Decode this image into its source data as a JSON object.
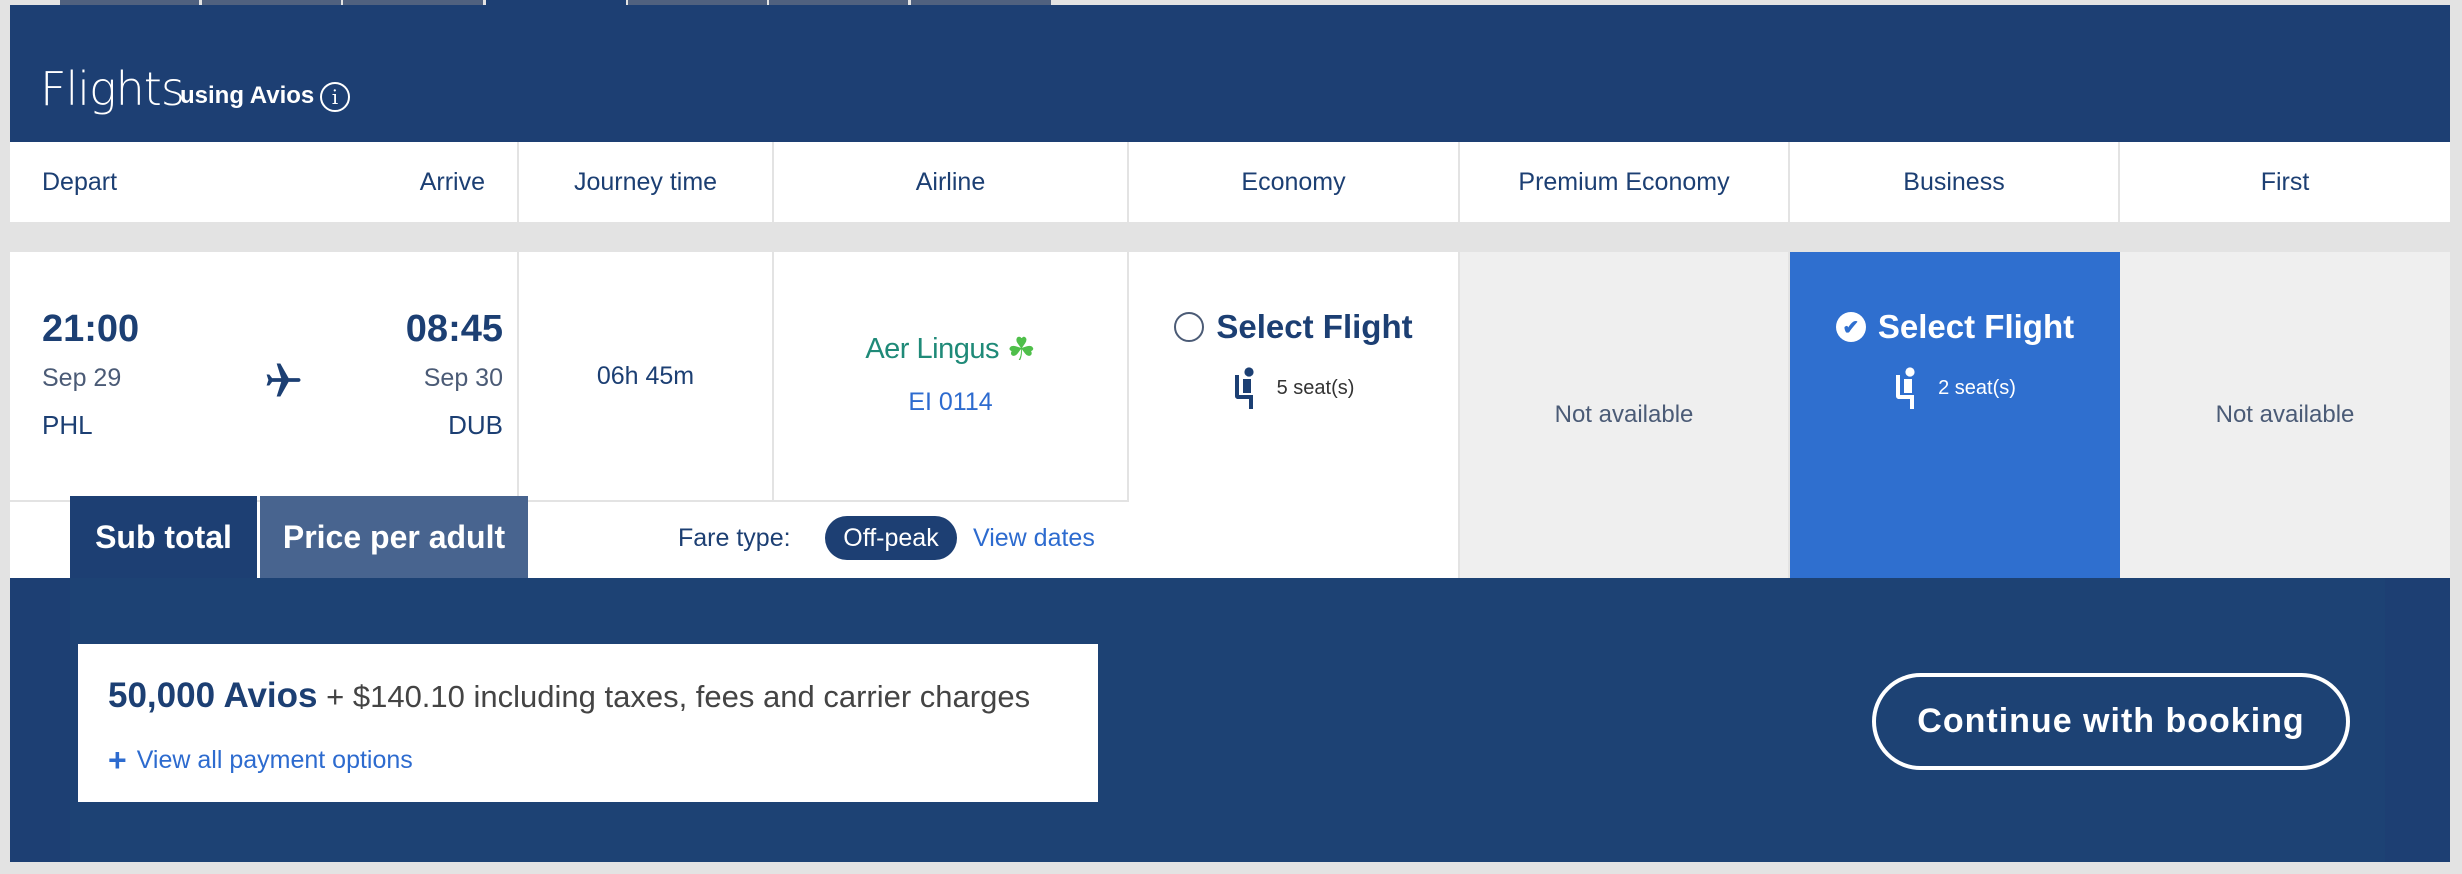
{
  "top_tabs": [
    {
      "label": ""
    },
    {
      "label": ""
    },
    {
      "label": ""
    },
    {
      "label": "",
      "selected": true
    },
    {
      "label": ""
    },
    {
      "label": ""
    },
    {
      "label": ""
    }
  ],
  "header": {
    "title": "Flights",
    "subtitle": "using Avios",
    "info_icon": "info-icon"
  },
  "columns": [
    "Depart",
    "Arrive",
    "Journey time",
    "Airline",
    "Economy",
    "Premium Economy",
    "Business",
    "First"
  ],
  "flight": {
    "depart_time": "21:00",
    "depart_date": "Sep 29",
    "depart_airport": "PHL",
    "arrive_time": "08:45",
    "arrive_date": "Sep 30",
    "arrive_airport": "DUB",
    "journey_time": "06h 45m",
    "airline_name": "Aer Lingus",
    "flight_number": "EI 0114",
    "economy": {
      "label": "Select Flight",
      "seats": "5 seat(s)",
      "selected": false
    },
    "premium_economy": {
      "label": "Not available"
    },
    "business": {
      "label": "Select Flight",
      "seats": "2 seat(s)",
      "selected": true
    },
    "first": {
      "label": "Not available"
    }
  },
  "price_tabs": {
    "subtotal": "Sub total",
    "per_adult": "Price per adult"
  },
  "fare": {
    "label": "Fare type:",
    "type": "Off-peak",
    "view_dates": "View dates"
  },
  "summary": {
    "avios": "50,000 Avios",
    "cash": "+ $140.10 including taxes, fees and carrier charges",
    "payment_options": "View all payment options"
  },
  "cta": {
    "label": "Continue with booking"
  },
  "colors": {
    "navy": "#1d3f73",
    "selected_blue": "#2f6fcf",
    "link_blue": "#2d6bcf",
    "aer_lingus_green": "#3aa67a"
  }
}
